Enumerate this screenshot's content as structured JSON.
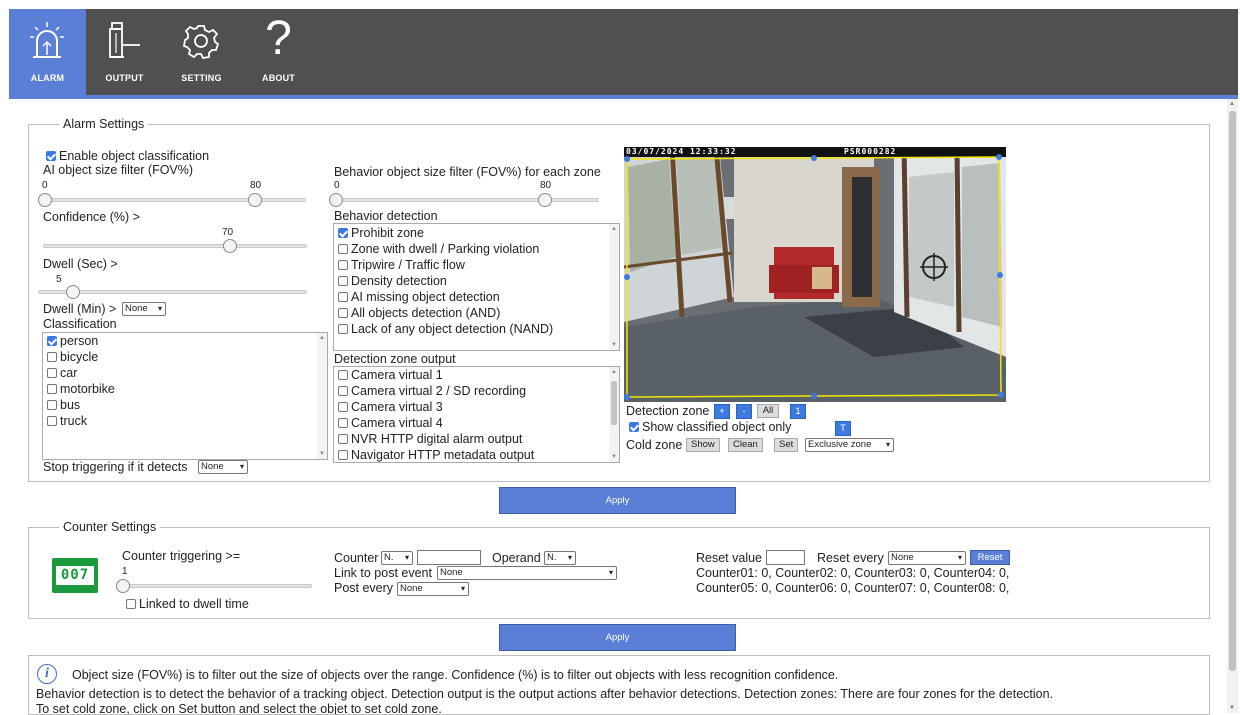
{
  "nav": {
    "tabs": [
      {
        "label": "ALARM",
        "icon": "alarm-icon"
      },
      {
        "label": "OUTPUT",
        "icon": "output-icon"
      },
      {
        "label": "SETTING",
        "icon": "gear-icon"
      },
      {
        "label": "ABOUT",
        "icon": "question-icon"
      }
    ],
    "active_tab": "ALARM",
    "about_glyph": "?"
  },
  "alarm": {
    "legend": "Alarm Settings",
    "enable_classification": {
      "label": "Enable object classification",
      "checked": true
    },
    "ai_size_filter": {
      "label": "AI object size filter (FOV%)",
      "min": "0",
      "max": "80",
      "value": 80
    },
    "confidence": {
      "label": "Confidence (%) >",
      "value": "70"
    },
    "dwell_sec": {
      "label": "Dwell (Sec) >",
      "value": "5"
    },
    "dwell_min": {
      "label": "Dwell (Min) >",
      "selected": "None"
    },
    "classification": {
      "label": "Classification",
      "items": [
        {
          "label": "person",
          "checked": true
        },
        {
          "label": "bicycle",
          "checked": false
        },
        {
          "label": "car",
          "checked": false
        },
        {
          "label": "motorbike",
          "checked": false
        },
        {
          "label": "bus",
          "checked": false
        },
        {
          "label": "truck",
          "checked": false
        }
      ]
    },
    "stop_triggering": {
      "label": "Stop triggering if it detects",
      "selected": "None"
    },
    "behavior_size_filter": {
      "label": "Behavior object size filter (FOV%) for each zone",
      "min": "0",
      "max": "80",
      "value": 80
    },
    "behavior_detection": {
      "label": "Behavior detection",
      "items": [
        {
          "label": "Prohibit zone",
          "checked": true
        },
        {
          "label": "Zone with dwell / Parking violation",
          "checked": false
        },
        {
          "label": "Tripwire / Traffic flow",
          "checked": false
        },
        {
          "label": "Density detection",
          "checked": false
        },
        {
          "label": "AI missing object detection",
          "checked": false
        },
        {
          "label": "All objects detection (AND)",
          "checked": false
        },
        {
          "label": "Lack of any object detection (NAND)",
          "checked": false
        }
      ]
    },
    "detection_zone_output": {
      "label": "Detection zone output",
      "items": [
        {
          "label": "Camera virtual 1",
          "checked": false
        },
        {
          "label": "Camera virtual 2 / SD recording",
          "checked": false
        },
        {
          "label": "Camera virtual 3",
          "checked": false
        },
        {
          "label": "Camera virtual 4",
          "checked": false
        },
        {
          "label": "NVR HTTP digital alarm output",
          "checked": false
        },
        {
          "label": "Navigator HTTP metadata output",
          "checked": false
        }
      ]
    },
    "camera": {
      "timestamp": "03/07/2024 12:33:32",
      "camera_id": "PSR000282",
      "zone_color": "#f2e600"
    },
    "detection_zone": {
      "label": "Detection zone",
      "plus": "+",
      "minus": "-",
      "all": "All",
      "zone_number": "1"
    },
    "show_classified": {
      "label": "Show classified object only",
      "checked": true,
      "toggle": "T"
    },
    "cold_zone": {
      "label": "Cold zone",
      "show": "Show",
      "clean": "Clean",
      "set": "Set",
      "mode": "Exclusive zone"
    },
    "apply_label": "Apply"
  },
  "counter": {
    "legend": "Counter Settings",
    "display_digits": "007",
    "triggering": {
      "label": "Counter triggering >=",
      "value": "1"
    },
    "linked_dwell": {
      "label": "Linked to dwell time",
      "checked": false
    },
    "counter_label": "Counter",
    "counter_select": "N.",
    "operand_label": "Operand",
    "operand_select": "N.",
    "link_post_label": "Link to post event",
    "link_post_select": "None",
    "post_every_label": "Post every",
    "post_every_select": "None",
    "reset_value_label": "Reset value",
    "reset_every_label": "Reset every",
    "reset_every_select": "None",
    "reset_button": "Reset",
    "values_line1": "Counter01: 0, Counter02: 0, Counter03: 0, Counter04: 0,",
    "values_line2": "Counter05: 0, Counter06: 0, Counter07: 0, Counter08: 0,",
    "apply_label": "Apply"
  },
  "info": {
    "line1": "Object size (FOV%) is to filter out the size of objects over the range. Confidence (%) is to filter out objects with less recognition confidence.",
    "line2": "Behavior detection is to detect the behavior of a tracking object. Detection output is the output actions after behavior detections. Detection zones: There are four zones for the detection.",
    "line3": "To set cold zone, click on Set button and select the objet to set cold zone."
  },
  "colors": {
    "topbar": "#505050",
    "accent": "#5b7fd6",
    "counter_green": "#1a9a3c"
  }
}
